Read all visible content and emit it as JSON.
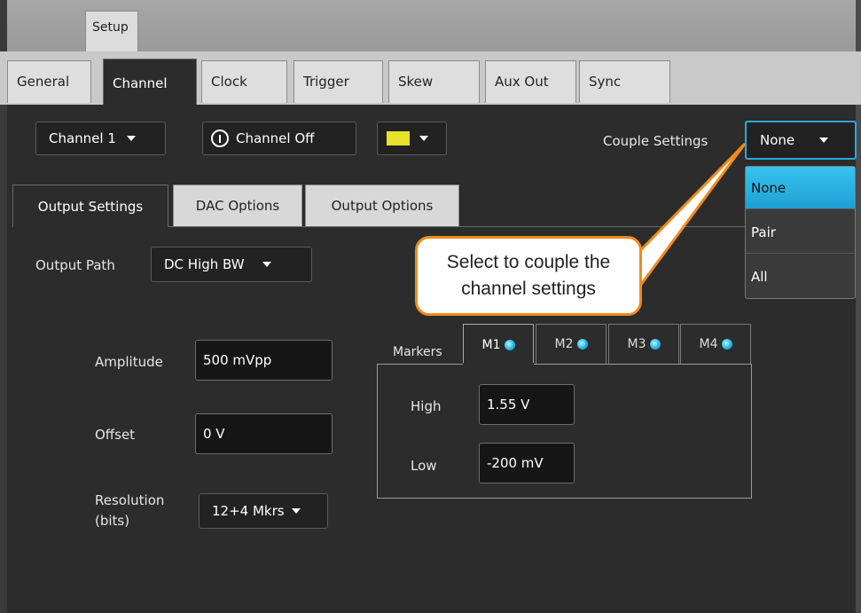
{
  "window": {
    "setup_tab": "Setup"
  },
  "main_tabs": [
    {
      "label": "General"
    },
    {
      "label": "Channel"
    },
    {
      "label": "Clock"
    },
    {
      "label": "Trigger"
    },
    {
      "label": "Skew"
    },
    {
      "label": "Aux Out"
    },
    {
      "label": "Sync"
    }
  ],
  "toolbar": {
    "channel_select": "Channel 1",
    "channel_toggle": "Channel Off",
    "channel_color": "#e8e02a",
    "couple_label": "Couple Settings",
    "couple_value": "None"
  },
  "couple_dropdown": {
    "options": [
      "None",
      "Pair",
      "All"
    ],
    "selected": "None"
  },
  "sub_tabs": [
    {
      "label": "Output Settings"
    },
    {
      "label": "DAC Options"
    },
    {
      "label": "Output Options"
    }
  ],
  "output": {
    "path_label": "Output Path",
    "path_value": "DC High BW",
    "amplitude_label": "Amplitude",
    "amplitude_value": "500 mVpp",
    "offset_label": "Offset",
    "offset_value": "0 V",
    "resolution_label_1": "Resolution",
    "resolution_label_2": "(bits)",
    "resolution_value": "12+4 Mkrs"
  },
  "markers": {
    "label": "Markers",
    "tabs": [
      "M1",
      "M2",
      "M3",
      "M4"
    ],
    "high_label": "High",
    "high_value": "1.55 V",
    "low_label": "Low",
    "low_value": "-200 mV"
  },
  "callout": {
    "line1": "Select to couple the",
    "line2": "channel settings"
  },
  "colors": {
    "accent": "#22b6e8",
    "callout_border": "#f08a1c"
  }
}
